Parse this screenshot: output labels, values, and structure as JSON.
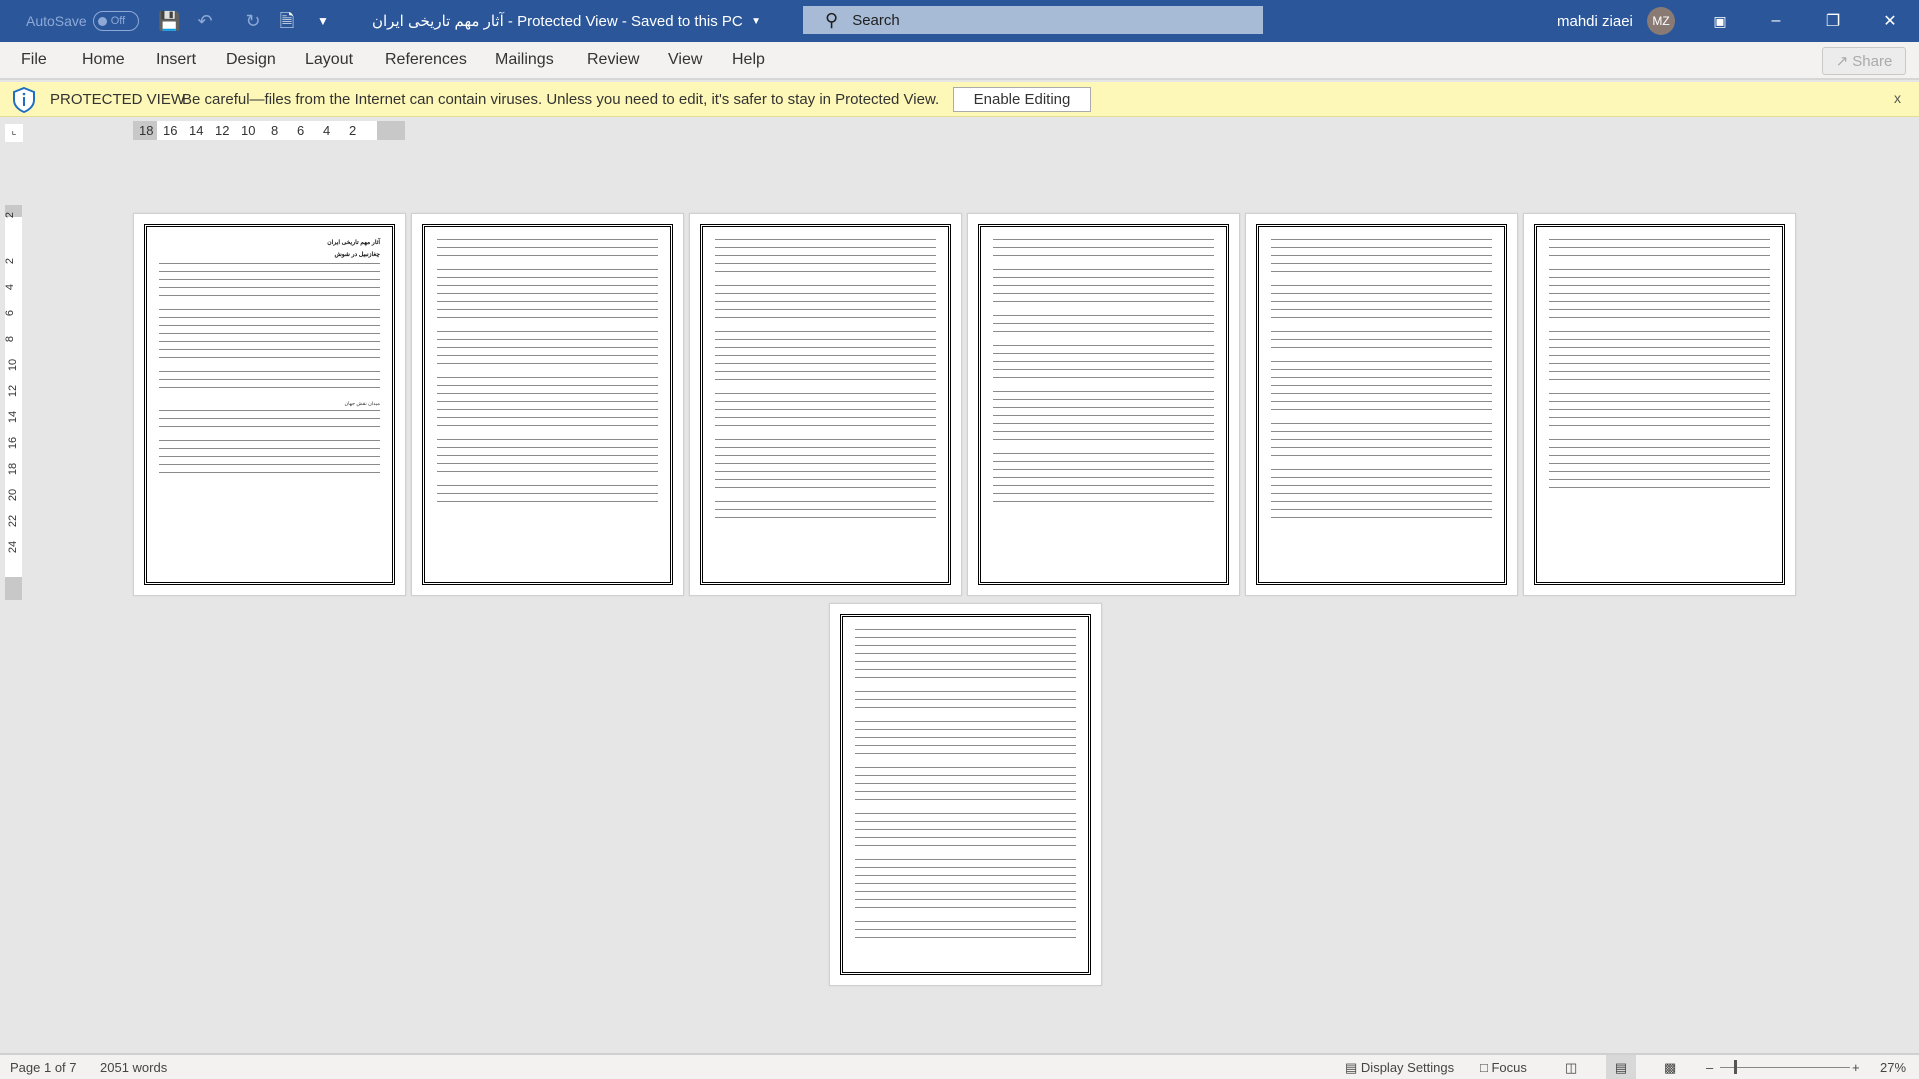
{
  "titlebar": {
    "autosave_label": "AutoSave",
    "autosave_state": "Off",
    "doc_title": "آثار مهم تاریخی ایران  -  Protected View  -  Saved to this PC",
    "search_placeholder": "Search",
    "user_name": "mahdi ziaei",
    "user_initials": "MZ"
  },
  "ribbon": {
    "tabs": [
      "File",
      "Home",
      "Insert",
      "Design",
      "Layout",
      "References",
      "Mailings",
      "Review",
      "View",
      "Help"
    ],
    "share_label": "Share"
  },
  "protected_view": {
    "title": "PROTECTED VIEW",
    "message": "Be careful—files from the Internet can contain viruses. Unless you need to edit, it's safer to stay in Protected View.",
    "enable_label": "Enable Editing",
    "close": "x"
  },
  "ruler": {
    "h_numbers": [
      "18",
      "16",
      "14",
      "12",
      "10",
      "8",
      "6",
      "4",
      "2"
    ],
    "v_numbers": [
      "2",
      "2",
      "4",
      "6",
      "8",
      "10",
      "12",
      "14",
      "16",
      "18",
      "20",
      "22",
      "24"
    ]
  },
  "document": {
    "title": "آثار مهم تاریخی ایران",
    "subtitle": "چغازنبیل در شوش",
    "section": "میدان نقش جهان"
  },
  "status": {
    "page": "Page 1 of 7",
    "words": "2051 words",
    "display_settings": "Display Settings",
    "focus": "Focus",
    "zoom": "27%"
  }
}
